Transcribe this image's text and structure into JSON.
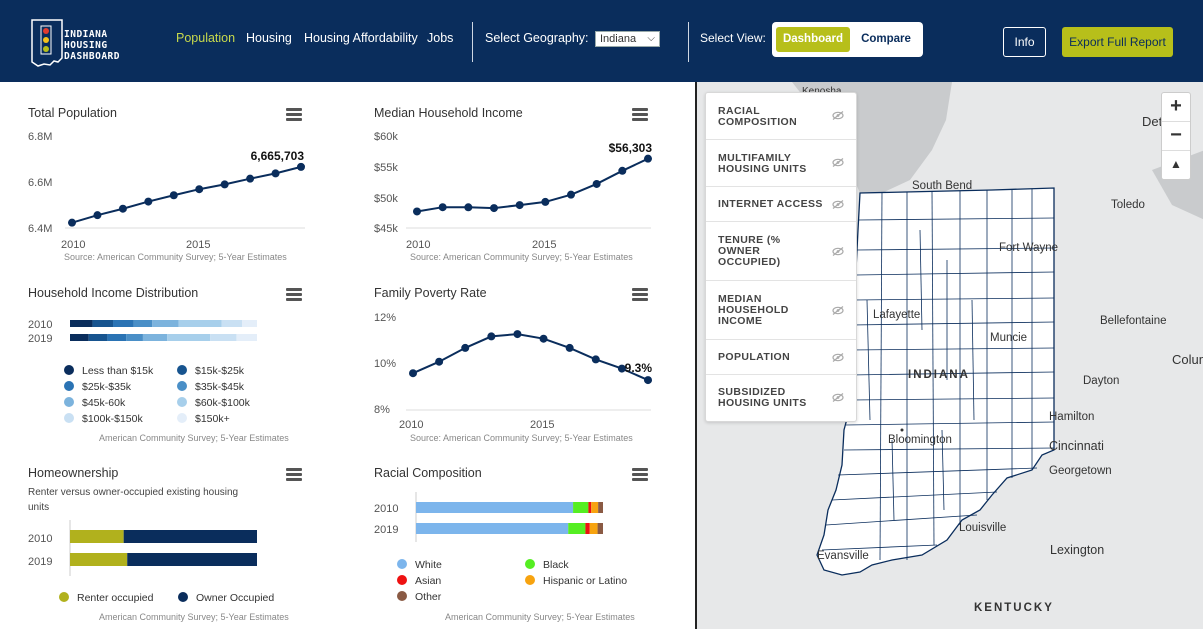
{
  "header": {
    "logo_text": "INDIANA HOUSING DASHBOARD",
    "nav": [
      "Population",
      "Housing",
      "Housing Affordability",
      "Jobs"
    ],
    "active_nav": "Population",
    "geo_label": "Select Geography:",
    "geo_value": "Indiana",
    "view_label": "Select View:",
    "view_dashboard": "Dashboard",
    "view_compare": "Compare",
    "info": "Info",
    "export": "Export Full Report",
    "colors": {
      "navy": "#0a2d5c",
      "olive": "#b7bf1a",
      "active": "#c7d94c"
    }
  },
  "charts": {
    "total_population": {
      "title": "Total Population",
      "source": "Source: American Community Survey; 5-Year Estimates",
      "yticks": [
        "6.8M",
        "6.6M",
        "6.4M"
      ],
      "xticks": [
        "2010",
        "2015"
      ],
      "last_label": "6,665,703"
    },
    "median_income": {
      "title": "Median Household Income",
      "source": "Source: American Community Survey; 5-Year Estimates",
      "yticks": [
        "$60k",
        "$55k",
        "$50k",
        "$45k"
      ],
      "xticks": [
        "2010",
        "2015"
      ],
      "last_label": "$56,303"
    },
    "income_distribution": {
      "title": "Household Income Distribution",
      "source": "American Community Survey; 5-Year Estimates",
      "legend": [
        "Less than $15k",
        "$15k-$25k",
        "$25k-$35k",
        "$35k-$45k",
        "$45k-60k",
        "$60k-$100k",
        "$100k-$150k",
        "$150k+"
      ]
    },
    "poverty": {
      "title": "Family Poverty Rate",
      "source": "Source: American Community Survey; 5-Year Estimates",
      "yticks": [
        "12%",
        "10%",
        "8%"
      ],
      "xticks": [
        "2010",
        "2015"
      ],
      "last_label": "9.3%"
    },
    "homeownership": {
      "title": "Homeownership",
      "subtitle": "Renter versus owner-occupied existing housing units",
      "source": "American Community Survey; 5-Year Estimates",
      "legend": [
        "Renter occupied",
        "Owner Occupied"
      ]
    },
    "racial": {
      "title": "Racial Composition",
      "source": "American Community Survey; 5-Year Estimates",
      "legend": [
        "White",
        "Black",
        "Asian",
        "Hispanic or Latino",
        "Other"
      ]
    }
  },
  "chart_data": [
    {
      "type": "line",
      "title": "Total Population",
      "x": [
        2010,
        2011,
        2012,
        2013,
        2014,
        2015,
        2016,
        2017,
        2018,
        2019
      ],
      "values": [
        6423113,
        6455752,
        6483802,
        6514861,
        6542411,
        6568645,
        6589578,
        6614418,
        6637426,
        6665703
      ],
      "ylim": [
        6400000,
        6800000
      ]
    },
    {
      "type": "line",
      "title": "Median Household Income",
      "x": [
        2010,
        2011,
        2012,
        2013,
        2014,
        2015,
        2016,
        2017,
        2018,
        2019
      ],
      "values": [
        47697,
        48393,
        48374,
        48248,
        48737,
        49255,
        50433,
        52182,
        54325,
        56303
      ],
      "ylim": [
        45000,
        60000
      ]
    },
    {
      "type": "bar",
      "title": "Household Income Distribution",
      "categories": [
        "2010",
        "2019"
      ],
      "series": [
        {
          "name": "Less than $15k",
          "values": [
            12,
            10
          ]
        },
        {
          "name": "$15k-$25k",
          "values": [
            11,
            10
          ]
        },
        {
          "name": "$25k-$35k",
          "values": [
            11,
            10
          ]
        },
        {
          "name": "$35k-$45k",
          "values": [
            10,
            9
          ]
        },
        {
          "name": "$45k-60k",
          "values": [
            14,
            13
          ]
        },
        {
          "name": "$60k-$100k",
          "values": [
            23,
            23
          ]
        },
        {
          "name": "$100k-$150k",
          "values": [
            11,
            14
          ]
        },
        {
          "name": "$150k+",
          "values": [
            8,
            11
          ]
        }
      ],
      "colors": [
        "#0a2d5c",
        "#17548f",
        "#2a73b4",
        "#4a8fc7",
        "#7cb3dd",
        "#a7cfeb",
        "#c9e0f3",
        "#e4eef9"
      ]
    },
    {
      "type": "line",
      "title": "Family Poverty Rate",
      "x": [
        2010,
        2011,
        2012,
        2013,
        2014,
        2015,
        2016,
        2017,
        2018,
        2019
      ],
      "values": [
        9.6,
        10.1,
        10.7,
        11.2,
        11.3,
        11.1,
        10.7,
        10.2,
        9.8,
        9.3
      ],
      "ylim": [
        8,
        12
      ]
    },
    {
      "type": "bar",
      "title": "Homeownership",
      "categories": [
        "2010",
        "2019"
      ],
      "series": [
        {
          "name": "Renter occupied",
          "values": [
            28.7,
            30.6
          ]
        },
        {
          "name": "Owner Occupied",
          "values": [
            71.3,
            69.4
          ]
        }
      ],
      "colors": [
        "#b1b11d",
        "#0a2d5c"
      ]
    },
    {
      "type": "bar",
      "title": "Racial Composition",
      "categories": [
        "2010",
        "2019"
      ],
      "series": [
        {
          "name": "White",
          "values": [
            84.0,
            81.4
          ]
        },
        {
          "name": "Black",
          "values": [
            8.2,
            9.2
          ]
        },
        {
          "name": "Asian",
          "values": [
            1.5,
            2.3
          ]
        },
        {
          "name": "Hispanic or Latino",
          "values": [
            3.7,
            4.2
          ]
        },
        {
          "name": "Other",
          "values": [
            2.6,
            2.9
          ]
        }
      ],
      "colors": [
        "#7cb5ec",
        "#55ee22",
        "#ee1111",
        "#f7a30f",
        "#8a5a44"
      ]
    }
  ],
  "map": {
    "layers": [
      "RACIAL COMPOSITION",
      "MULTIFAMILY HOUSING UNITS",
      "INTERNET ACCESS",
      "TENURE (% OWNER OCCUPIED)",
      "MEDIAN HOUSEHOLD INCOME",
      "POPULATION",
      "SUBSIDIZED HOUSING UNITS"
    ],
    "zoom_in": "+",
    "zoom_out": "−",
    "compass": "▲",
    "places": [
      "Kenosha",
      "Detroit",
      "South Bend",
      "Toledo",
      "Fort Wayne",
      "Bellefontaine",
      "Lafayette",
      "Muncie",
      "Columbus",
      "INDIANA",
      "Dayton",
      "Hamilton",
      "Cincinnati",
      "Bloomington",
      "Georgetown",
      "Louisville",
      "Evansville",
      "Lexington",
      "KENTUCKY"
    ],
    "places_display": {
      "Kenosha": "Kenosha",
      "Detroit": "Det",
      "Columbus": "Colum",
      "Cincinnati": "Cincinnati"
    }
  }
}
